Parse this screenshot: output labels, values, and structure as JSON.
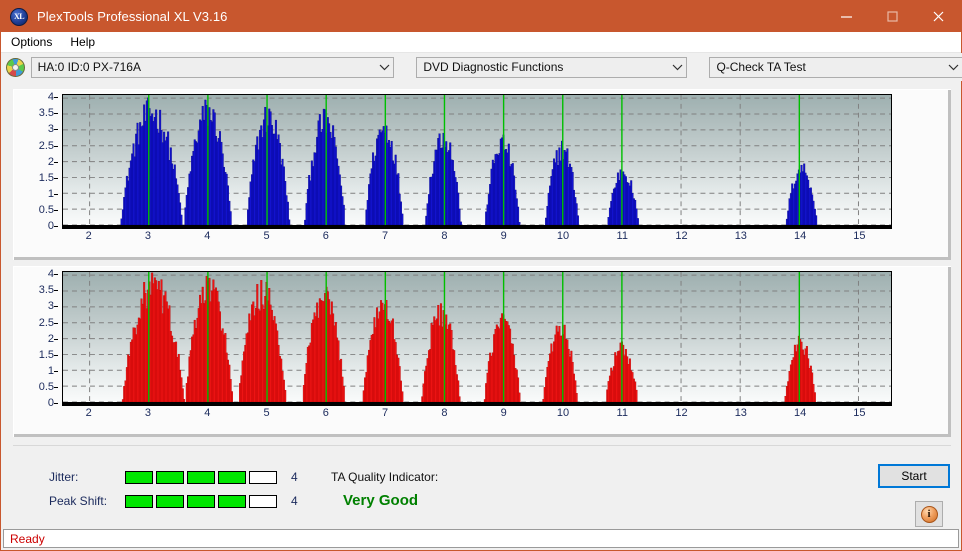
{
  "window": {
    "title": "PlexTools Professional XL V3.16",
    "icon": "xl-logo-icon",
    "titlebar_color": "#c8572e",
    "controls": {
      "minimize": "minimize-icon",
      "maximize": "maximize-icon",
      "close": "close-icon"
    }
  },
  "menu": {
    "items": [
      {
        "label": "Options"
      },
      {
        "label": "Help"
      }
    ]
  },
  "toolbar": {
    "disc_icon": "disc-icon",
    "drive_selector": {
      "value": "HA:0 ID:0  PX-716A",
      "arrow": "chevron-down-icon"
    },
    "function_selector": {
      "value": "DVD Diagnostic Functions",
      "arrow": "chevron-down-icon"
    },
    "test_selector": {
      "value": "Q-Check TA Test",
      "arrow": "chevron-down-icon"
    }
  },
  "results": {
    "jitter": {
      "label": "Jitter:",
      "value": "4",
      "filled": 4,
      "total": 5
    },
    "peak_shift": {
      "label": "Peak Shift:",
      "value": "4",
      "filled": 4,
      "total": 5
    },
    "ta_quality": {
      "label": "TA Quality Indicator:",
      "value": "Very Good",
      "color": "#008000"
    },
    "start_button": "Start",
    "info_button": "i"
  },
  "statusbar": {
    "text": "Ready",
    "color": "#cc0000"
  },
  "chart_data": [
    {
      "id": "ta-jitter-chart",
      "type": "bar",
      "title": "",
      "xlabel": "",
      "ylabel": "",
      "series_color": "#1414d2",
      "bar_edge_color": "#000080",
      "xlim": [
        1.55,
        15.55
      ],
      "ylim": [
        0,
        4.1
      ],
      "yticks": [
        0,
        0.5,
        1,
        1.5,
        2,
        2.5,
        3,
        3.5,
        4
      ],
      "ytick_labels": [
        "0",
        "0.5",
        "1",
        "1.5",
        "2",
        "2.5",
        "3",
        "3.5",
        "4"
      ],
      "xticks": [
        2,
        3,
        4,
        5,
        6,
        7,
        8,
        9,
        10,
        11,
        12,
        13,
        14,
        15
      ],
      "xtick_labels": [
        "2",
        "3",
        "4",
        "5",
        "6",
        "7",
        "8",
        "9",
        "10",
        "11",
        "12",
        "13",
        "14",
        "15"
      ],
      "grid": true,
      "grid_color": "#808080",
      "markers": {
        "color": "#00c000",
        "x": [
          3,
          4,
          5,
          6,
          7,
          8,
          9,
          10,
          11,
          14
        ]
      },
      "peaks": [
        {
          "center": 3.05,
          "peak": 3.7,
          "half_width": 0.52
        },
        {
          "center": 4.0,
          "peak": 3.7,
          "half_width": 0.4
        },
        {
          "center": 5.02,
          "peak": 3.55,
          "half_width": 0.36
        },
        {
          "center": 5.98,
          "peak": 3.4,
          "half_width": 0.34
        },
        {
          "center": 6.98,
          "peak": 3.2,
          "half_width": 0.32
        },
        {
          "center": 7.98,
          "peak": 2.95,
          "half_width": 0.3
        },
        {
          "center": 8.98,
          "peak": 2.7,
          "half_width": 0.29
        },
        {
          "center": 9.99,
          "peak": 2.5,
          "half_width": 0.28
        },
        {
          "center": 11.02,
          "peak": 1.76,
          "half_width": 0.26
        },
        {
          "center": 14.04,
          "peak": 1.88,
          "half_width": 0.26
        }
      ]
    },
    {
      "id": "ta-peakshift-chart",
      "type": "bar",
      "title": "",
      "xlabel": "",
      "ylabel": "",
      "series_color": "#ef1414",
      "bar_edge_color": "#b00000",
      "xlim": [
        1.55,
        15.55
      ],
      "ylim": [
        0,
        4.1
      ],
      "yticks": [
        0,
        0.5,
        1,
        1.5,
        2,
        2.5,
        3,
        3.5,
        4
      ],
      "ytick_labels": [
        "0",
        "0.5",
        "1",
        "1.5",
        "2",
        "2.5",
        "3",
        "3.5",
        "4"
      ],
      "xticks": [
        2,
        3,
        4,
        5,
        6,
        7,
        8,
        9,
        10,
        11,
        12,
        13,
        14,
        15
      ],
      "xtick_labels": [
        "2",
        "3",
        "4",
        "5",
        "6",
        "7",
        "8",
        "9",
        "10",
        "11",
        "12",
        "13",
        "14",
        "15"
      ],
      "grid": true,
      "grid_color": "#808080",
      "markers": {
        "color": "#00c000",
        "x": [
          3,
          4,
          5,
          6,
          7,
          8,
          9,
          10,
          11,
          14
        ]
      },
      "peaks": [
        {
          "center": 3.08,
          "peak": 3.78,
          "half_width": 0.52
        },
        {
          "center": 4.02,
          "peak": 3.74,
          "half_width": 0.4
        },
        {
          "center": 4.92,
          "peak": 3.58,
          "half_width": 0.4
        },
        {
          "center": 5.96,
          "peak": 3.36,
          "half_width": 0.36
        },
        {
          "center": 6.96,
          "peak": 3.18,
          "half_width": 0.34
        },
        {
          "center": 7.94,
          "peak": 2.94,
          "half_width": 0.32
        },
        {
          "center": 8.98,
          "peak": 2.68,
          "half_width": 0.3
        },
        {
          "center": 9.96,
          "peak": 2.42,
          "half_width": 0.29
        },
        {
          "center": 11.0,
          "peak": 1.74,
          "half_width": 0.27
        },
        {
          "center": 14.02,
          "peak": 1.92,
          "half_width": 0.26
        }
      ]
    }
  ]
}
